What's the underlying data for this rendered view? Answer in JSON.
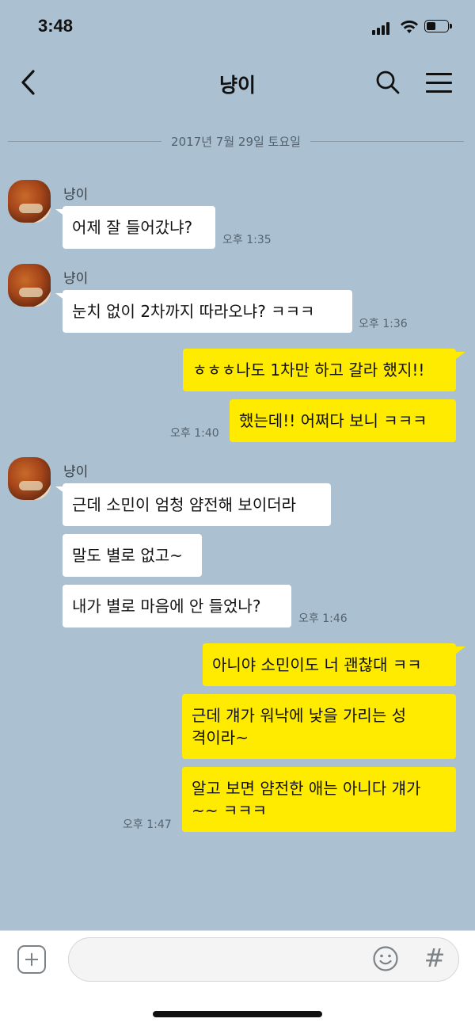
{
  "status_bar": {
    "time": "3:48",
    "icons": [
      "signal-icon",
      "wifi-icon",
      "battery-icon"
    ]
  },
  "header": {
    "title": "냥이",
    "icons": [
      "back-chevron-icon",
      "search-icon",
      "menu-icon"
    ]
  },
  "date_divider": "2017년 7월 29일 토요일",
  "messages": [
    {
      "sender": "냥이",
      "direction": "in",
      "text": "어제 잘 들어갔냐?",
      "time": "오후 1:35"
    },
    {
      "sender": "냥이",
      "direction": "in",
      "text": "눈치 없이 2차까지 따라오냐? ㅋㅋㅋ",
      "time": "오후 1:36"
    },
    {
      "direction": "out",
      "text": "ㅎㅎㅎ나도 1차만 하고 갈라 했지!!"
    },
    {
      "direction": "out",
      "text": "했는데!! 어쩌다 보니 ㅋㅋㅋ",
      "time": "오후 1:40"
    },
    {
      "sender": "냥이",
      "direction": "in",
      "text": "근데 소민이 엄청 얌전해 보이더라"
    },
    {
      "direction": "in",
      "text": "말도 별로 없고~"
    },
    {
      "direction": "in",
      "text": "내가 별로 마음에 안 들었나?",
      "time": "오후 1:46"
    },
    {
      "direction": "out",
      "text": "아니야 소민이도 너 괜찮대 ㅋㅋ"
    },
    {
      "direction": "out",
      "text": "근데 걔가 워낙에 낯을 가리는 성\n격이라~"
    },
    {
      "direction": "out",
      "text": "알고 보면 얌전한 애는 아니다 걔가\n~~ ㅋㅋㅋ",
      "time": "오후 1:47"
    }
  ],
  "input_bar": {
    "placeholder": "",
    "hash_label": "#",
    "icons": [
      "plus-icon",
      "emoji-icon"
    ]
  },
  "colors": {
    "background": "#abc1d1",
    "my_bubble": "#ffeb00",
    "their_bubble": "#ffffff"
  }
}
